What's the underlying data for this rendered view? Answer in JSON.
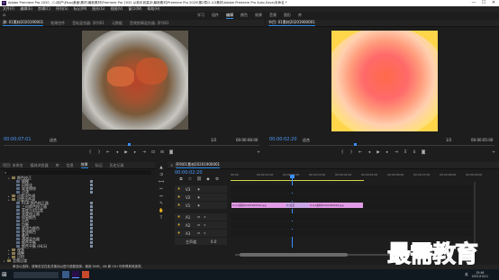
{
  "window": {
    "title": "Adobe Premiere Pro 2020 - C:\\用户\\Etup\\桌面\\素材\\最新素材\\Premiere Pro 2020 从新手到高手\\最新素材\\Premiere Pro 2020\\第2章\\2.4.5素材\\Adobe Premiere Pro Auto-Save\\未命名 *",
    "minimize": "—",
    "maximize": "☐",
    "close": "✕"
  },
  "menu": [
    "文件(F)",
    "编辑(E)",
    "剪辑(C)",
    "序列(S)",
    "标记(M)",
    "图形(G)",
    "视图(V)",
    "窗口(W)",
    "帮助(H)"
  ],
  "workspaces": [
    "学习",
    "组件",
    "编辑",
    "颜色",
    "效果",
    "音频",
    "图形",
    "库"
  ],
  "source": {
    "tabs": [
      "源: 01素材2020190001",
      "效果控件",
      "音轨混合器: 序列01",
      "元数据",
      "音频剪辑混合器: 序列01"
    ],
    "timecode": "00:00:07:01",
    "fit": "适合",
    "fraction": "1/2",
    "duration": "00:00:08:00"
  },
  "program": {
    "tabs": [
      "节目: 01素材20201900001"
    ],
    "timecode": "00:00:02:20",
    "fit": "适合",
    "fraction": "1/2",
    "duration": "00:00:05:00"
  },
  "effects": {
    "tabs": [
      "项目: 未命名",
      "媒体浏览器",
      "库",
      "信息",
      "效果",
      "标记",
      "历史记录"
    ],
    "items": [
      {
        "label": "颜色校正",
        "indent": 1,
        "folder": true
      },
      {
        "label": "模糊",
        "indent": 2,
        "folder": false
      },
      {
        "label": "风格化",
        "indent": 2,
        "folder": false
      },
      {
        "label": "渐变擦除",
        "indent": 2,
        "folder": false
      },
      {
        "label": "过滤",
        "indent": 2,
        "folder": false
      },
      {
        "label": "过度淡色调",
        "indent": 1,
        "folder": true
      },
      {
        "label": "过度淡色调",
        "indent": 1,
        "folder": true
      },
      {
        "label": "RGB 颜色校正器",
        "indent": 2,
        "folder": false
      },
      {
        "label": "三向颜色校正器",
        "indent": 2,
        "folder": false
      },
      {
        "label": "亮度与对比度",
        "indent": 2,
        "folder": false
      },
      {
        "label": "亮度校正器",
        "indent": 2,
        "folder": false
      },
      {
        "label": "保留颜色",
        "indent": 2,
        "folder": false
      },
      {
        "label": "分色",
        "indent": 2,
        "folder": false
      },
      {
        "label": "均衡",
        "indent": 2,
        "folder": false
      },
      {
        "label": "更改为颜色",
        "indent": 2,
        "folder": false
      },
      {
        "label": "更改颜色",
        "indent": 2,
        "folder": false
      },
      {
        "label": "着色",
        "indent": 2,
        "folder": false
      },
      {
        "label": "通道混合器",
        "indent": 2,
        "folder": false
      },
      {
        "label": "颜色平衡",
        "indent": 2,
        "folder": false
      },
      {
        "label": "颜色平衡 (HLS)",
        "indent": 2,
        "folder": false
      },
      {
        "label": "视频",
        "indent": 1,
        "folder": true
      },
      {
        "label": "调整",
        "indent": 1,
        "folder": true
      },
      {
        "label": "过时",
        "indent": 1,
        "folder": true
      },
      {
        "label": "音频过渡",
        "indent": 0,
        "folder": true
      }
    ]
  },
  "timeline": {
    "tabs": [
      "序列01素材20201900001"
    ],
    "timecode": "00:00:02:20",
    "ruler": [
      "00:00",
      "00:00:01:00",
      "00:00:02:00",
      "00:00:03:00",
      "00:00:04:00",
      "00:00:05:00",
      "00:00:06:00",
      "00:00:07:00",
      "00:00:08:00",
      "00:00:09:00"
    ],
    "tracks": [
      "V3",
      "V2",
      "V1",
      "A1",
      "A2",
      "A3"
    ],
    "master": "主声道",
    "master_val": "0.0",
    "clips": [
      {
        "label": "fx 01素材20201900001.jpg",
        "track": "V1"
      },
      {
        "label": "fx 交叉",
        "track": "V1"
      },
      {
        "label": "fx 01素材20201900004.jpg",
        "track": "V1"
      }
    ],
    "toolbar_icons": [
      "selection-icon",
      "track-select-icon",
      "ripple-edit-icon",
      "razor-icon",
      "slip-icon",
      "pen-icon",
      "hand-icon",
      "type-icon"
    ]
  },
  "status": {
    "text": "单击以选择，或单击空白处并拖动以进行选框选择。使用 Shift、Alt 和 Ctrl 可获得其他选项。"
  },
  "watermark": "最需教育",
  "taskbar": {
    "time": "15:46",
    "date": "2021/10/11",
    "lang": "英"
  },
  "colors": {
    "accent": "#2d8ceb",
    "timecode": "#4e9bff",
    "clip": "#e29be6",
    "watermark": "#1a3aa6"
  }
}
